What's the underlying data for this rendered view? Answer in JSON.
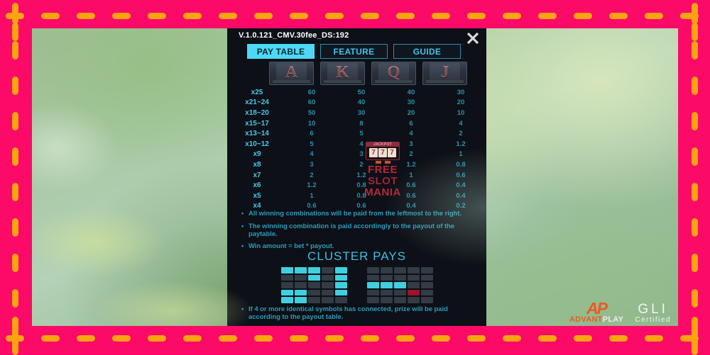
{
  "frame": {
    "border_color": "#FB0A67",
    "dash_color": "#FCA311"
  },
  "panel": {
    "version": "V.1.0.121_CMV.30fee_DS:192",
    "close_icon": "close-icon",
    "background": "#0d1017",
    "accent": "#3fc4e8"
  },
  "tabs": [
    {
      "label": "PAY TABLE",
      "active": true
    },
    {
      "label": "FEATURE",
      "active": false
    },
    {
      "label": "GUIDE",
      "active": false
    }
  ],
  "symbols": [
    {
      "letter": "A",
      "name": "symbol-ace"
    },
    {
      "letter": "K",
      "name": "symbol-king"
    },
    {
      "letter": "Q",
      "name": "symbol-queen"
    },
    {
      "letter": "J",
      "name": "symbol-jack"
    }
  ],
  "paytable": {
    "columns": [
      "A",
      "K",
      "Q",
      "J"
    ],
    "rows": [
      {
        "multiplier": "x25",
        "values": [
          "60",
          "50",
          "40",
          "30"
        ]
      },
      {
        "multiplier": "x21~24",
        "values": [
          "60",
          "40",
          "30",
          "20"
        ]
      },
      {
        "multiplier": "x18~20",
        "values": [
          "50",
          "30",
          "20",
          "10"
        ]
      },
      {
        "multiplier": "x15~17",
        "values": [
          "10",
          "8",
          "6",
          "4"
        ]
      },
      {
        "multiplier": "x13~14",
        "values": [
          "6",
          "5",
          "4",
          "2"
        ]
      },
      {
        "multiplier": "x10~12",
        "values": [
          "5",
          "4",
          "3",
          "1.2"
        ]
      },
      {
        "multiplier": "x9",
        "values": [
          "4",
          "3",
          "2",
          "1"
        ]
      },
      {
        "multiplier": "x8",
        "values": [
          "3",
          "2",
          "1.2",
          "0.8"
        ]
      },
      {
        "multiplier": "x7",
        "values": [
          "2",
          "1.2",
          "1",
          "0.6"
        ]
      },
      {
        "multiplier": "x6",
        "values": [
          "1.2",
          "0.8",
          "0.6",
          "0.4"
        ]
      },
      {
        "multiplier": "x5",
        "values": [
          "1",
          "0.8",
          "0.6",
          "0.4"
        ]
      },
      {
        "multiplier": "x4",
        "values": [
          "0.6",
          "0.6",
          "0.4",
          "0.2"
        ]
      }
    ]
  },
  "rules_top": [
    "All winning combinations will be paid from the leftmost to the right.",
    "The winning combination is paid accordingly to the payout of the paytable.",
    "Win amount = bet * payout."
  ],
  "cluster": {
    "title": "CLUSTER PAYS",
    "grids": [
      {
        "name": "cluster-example-win",
        "cells": [
          [
            "on",
            "on",
            "on",
            "off",
            "on"
          ],
          [
            "off",
            "off",
            "on",
            "off",
            "on"
          ],
          [
            "off",
            "off",
            "off",
            "off",
            "on"
          ],
          [
            "on",
            "on",
            "off",
            "off",
            "on"
          ],
          [
            "on",
            "on",
            "off",
            "off",
            "off"
          ]
        ]
      },
      {
        "name": "cluster-example-lose",
        "cells": [
          [
            "off",
            "off",
            "off",
            "off",
            "off"
          ],
          [
            "off",
            "off",
            "off",
            "off",
            "off"
          ],
          [
            "on",
            "on",
            "on",
            "off",
            "off"
          ],
          [
            "off",
            "off",
            "off",
            "red",
            "off"
          ],
          [
            "off",
            "off",
            "off",
            "off",
            "off"
          ]
        ]
      }
    ]
  },
  "rules_bottom": [
    "If 4 or more identical symbols has connected, prize will be paid according to the payout table."
  ],
  "watermark": {
    "jackpot_label": "JACKPOT",
    "reels": [
      "7",
      "7",
      "7"
    ],
    "line1": "FREE",
    "line2": "SLOT",
    "line3": "MANIA"
  },
  "logos": {
    "advantplay": {
      "mark": "AP",
      "text_orange": "ADVANT",
      "text_white": "PLAY"
    },
    "gli": {
      "main": "GLI",
      "sub": "Certified"
    }
  }
}
